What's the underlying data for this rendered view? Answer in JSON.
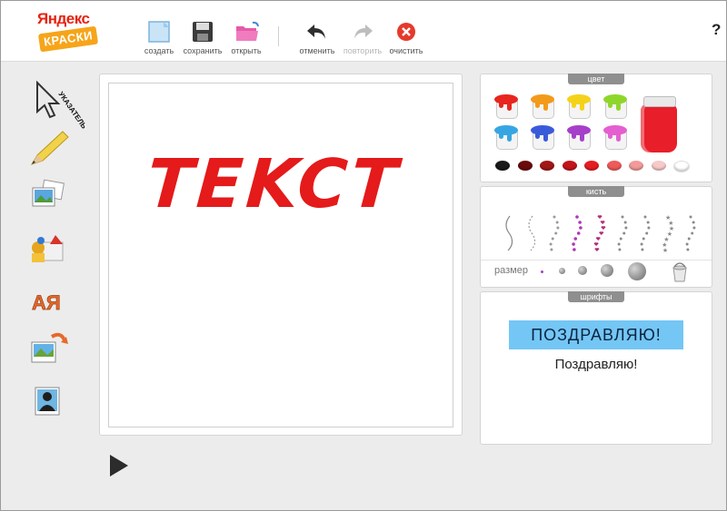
{
  "app": {
    "logo_line1": "Яндекс",
    "logo_line2": "КРАСКИ"
  },
  "toolbar": {
    "create_label": "создать",
    "save_label": "сохранить",
    "open_label": "открыть",
    "undo_label": "отменить",
    "redo_label": "повторить",
    "clear_label": "очистить",
    "help_label": "?"
  },
  "tools": {
    "pointer_label": "УКАЗАТЕЛЬ",
    "text_tool_label": "АЯ"
  },
  "canvas": {
    "drawn_text": "TEKCT"
  },
  "colors_panel": {
    "title": "цвет",
    "pots": [
      "#e8251f",
      "#f39a1a",
      "#f5d21a",
      "#8fd62c",
      "#36a6e2",
      "#3a5bd9",
      "#a63fc9",
      "#e45fd0"
    ],
    "jar_color": "#e81e2a",
    "swatches": [
      "#1a1a1a",
      "#6b0a0a",
      "#a11616",
      "#c4141b",
      "#e51d23",
      "#ef5a5a",
      "#f39a9a",
      "#f7c9c9",
      "#ffffff"
    ]
  },
  "brush_panel": {
    "title": "кисть",
    "size_label": "размер",
    "brush_colors": [
      "#888888",
      "#999999",
      "#9a9a9a",
      "#b035b8",
      "#b42d7a",
      "#8a8a8a",
      "#8a8a8a",
      "#8a8a8a",
      "#8a8a8a"
    ],
    "selected_brush": 4
  },
  "fonts_panel": {
    "title": "шрифты",
    "sample_banner": "ПОЗДРАВЛЯЮ!",
    "sample_text": "Поздравляю!"
  }
}
